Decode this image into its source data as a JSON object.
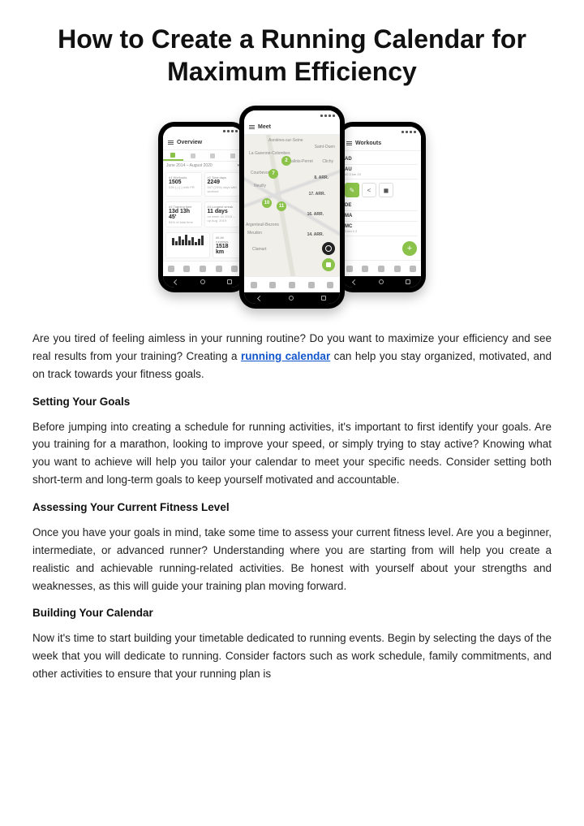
{
  "title": "How to Create a Running Calendar for Maximum Efficiency",
  "phones": {
    "left": {
      "header": "Overview",
      "range": "June 2014 – August 2020",
      "cards": [
        {
          "label": "#1 Workouts",
          "value": "1505",
          "sub": "535 (-) (-) with PR"
        },
        {
          "label": "#2 Total days",
          "value": "2249",
          "sub": "507 (23%) days with workout"
        },
        {
          "label": "#3 Training time",
          "value": "13d 13h 45'",
          "sub": "54% of total time"
        },
        {
          "label": "#4 Longest streak",
          "value": "11 days",
          "sub": "on week 40 2015 – up Aug. 2019"
        },
        {
          "label": "#5 All runnings",
          "value": "1518 km",
          "sub": ""
        }
      ]
    },
    "center": {
      "header": "Meet",
      "places": [
        "Asnières-sur-Seine",
        "La Garenne-Colombes",
        "Courbevoie",
        "Levallois-Perret",
        "Clichy",
        "Saint-Ouen",
        "Argenteuil-Bezons",
        "Meudon",
        "Clamart",
        "Neuilly"
      ],
      "arr": [
        "8. ARR.",
        "17. ARR.",
        "16. ARR.",
        "14. ARR."
      ],
      "pins": [
        "2",
        "7",
        "10",
        "11"
      ]
    },
    "right": {
      "header": "Workouts",
      "items": [
        {
          "t": "AD",
          "s": ""
        },
        {
          "t": "AU",
          "s": "42.3 km    23"
        },
        {
          "t": "DE",
          "s": ""
        },
        {
          "t": "MA",
          "s": ""
        },
        {
          "t": "MC",
          "s": "3 km   1   2"
        }
      ]
    }
  },
  "article": {
    "intro_a": "Are you tired of feeling aimless in your running routine? Do you want to maximize your efficiency and see real results from your training? Creating a ",
    "intro_link": "running calendar",
    "intro_b": " can help you stay organized, motivated, and on track towards your fitness goals.",
    "h1": "Setting Your Goals",
    "p1": "Before jumping into creating a schedule for running activities, it's important to first identify your goals. Are you training for a marathon, looking to improve your speed, or simply trying to stay active? Knowing what you want to achieve will help you tailor your calendar to meet your specific needs. Consider setting both short-term and long-term goals to keep yourself motivated and accountable.",
    "h2": "Assessing Your Current Fitness Level",
    "p2": "Once you have your goals in mind, take some time to assess your current fitness level. Are you a beginner, intermediate, or advanced runner? Understanding where you are starting from will help you create a realistic and achievable running-related activities. Be honest with yourself about your strengths and weaknesses, as this will guide your training plan moving forward.",
    "h3": "Building Your Calendar",
    "p3": "Now it's time to start building your timetable dedicated to running events. Begin by selecting the days of the week that you will dedicate to running. Consider factors such as work schedule, family commitments, and other activities to ensure that your running plan is"
  }
}
